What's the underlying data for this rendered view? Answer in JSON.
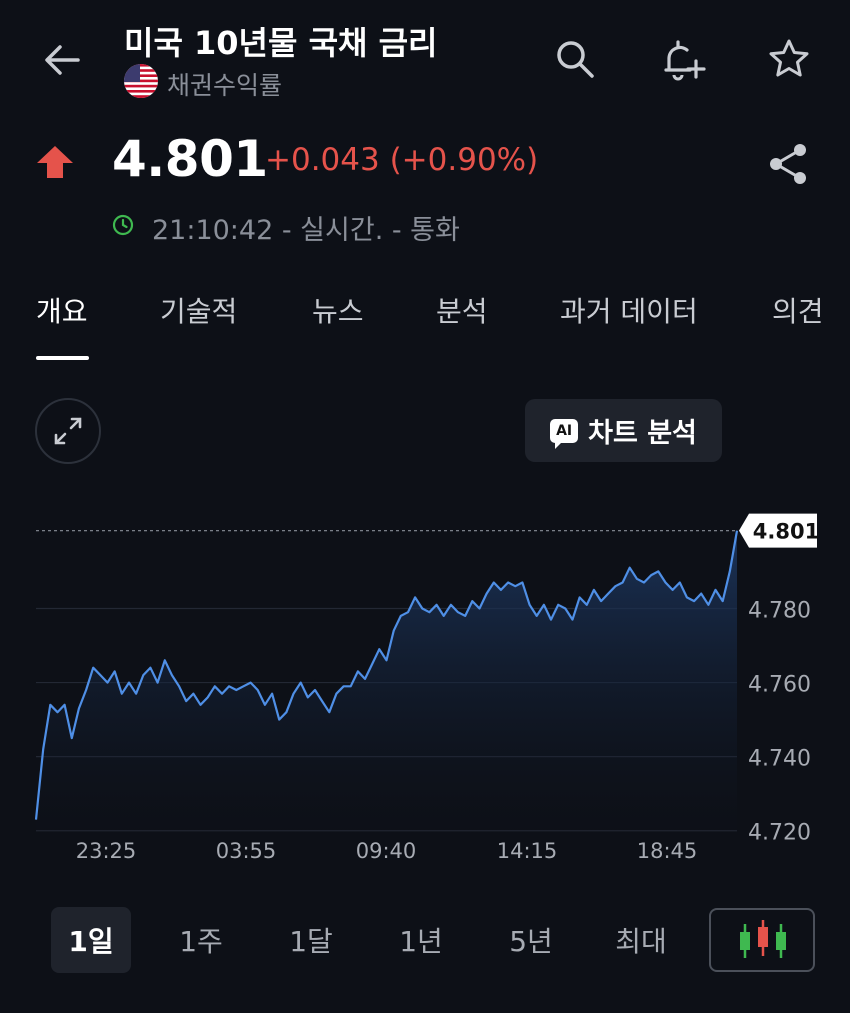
{
  "header": {
    "title": "미국 10년물 국채 금리",
    "subtitle": "채권수익률"
  },
  "quote": {
    "price": "4.801",
    "change": "+0.043 (+0.90%)",
    "status": "21:10:42 - 실시간. - 통화",
    "direction": "up",
    "up_color": "#e5534b"
  },
  "tabs": [
    "개요",
    "기술적",
    "뉴스",
    "분석",
    "과거 데이터",
    "의견"
  ],
  "chart_controls": {
    "ai_label": "차트 분석",
    "ai_badge": "AI"
  },
  "ranges": [
    "1일",
    "1주",
    "1달",
    "1년",
    "5년",
    "최대"
  ],
  "chart_data": {
    "type": "area",
    "title": "",
    "xlabel": "",
    "ylabel": "",
    "x_ticks": [
      "23:25",
      "03:55",
      "09:40",
      "14:15",
      "18:45"
    ],
    "y_ticks": [
      "4.780",
      "4.760",
      "4.740",
      "4.720"
    ],
    "ylim": [
      4.7175,
      4.8055
    ],
    "last_value_label": "4.801",
    "series": [
      {
        "values": [
          4.723,
          4.742,
          4.754,
          4.752,
          4.754,
          4.745,
          4.753,
          4.758,
          4.764,
          4.762,
          4.76,
          4.763,
          4.757,
          4.76,
          4.757,
          4.762,
          4.764,
          4.76,
          4.766,
          4.762,
          4.759,
          4.755,
          4.757,
          4.754,
          4.756,
          4.759,
          4.757,
          4.759,
          4.758,
          4.759,
          4.76,
          4.758,
          4.754,
          4.757,
          4.75,
          4.752,
          4.757,
          4.76,
          4.756,
          4.758,
          4.755,
          4.752,
          4.757,
          4.759,
          4.759,
          4.763,
          4.761,
          4.765,
          4.769,
          4.766,
          4.774,
          4.778,
          4.779,
          4.783,
          4.78,
          4.779,
          4.781,
          4.778,
          4.781,
          4.779,
          4.778,
          4.782,
          4.78,
          4.784,
          4.787,
          4.785,
          4.787,
          4.786,
          4.787,
          4.781,
          4.778,
          4.781,
          4.777,
          4.781,
          4.78,
          4.777,
          4.783,
          4.781,
          4.785,
          4.782,
          4.784,
          4.786,
          4.787,
          4.791,
          4.788,
          4.787,
          4.789,
          4.79,
          4.787,
          4.785,
          4.787,
          4.783,
          4.782,
          4.784,
          4.781,
          4.785,
          4.782,
          4.79,
          4.801
        ]
      }
    ],
    "line_color": "#4f8fe6",
    "grid": true
  }
}
